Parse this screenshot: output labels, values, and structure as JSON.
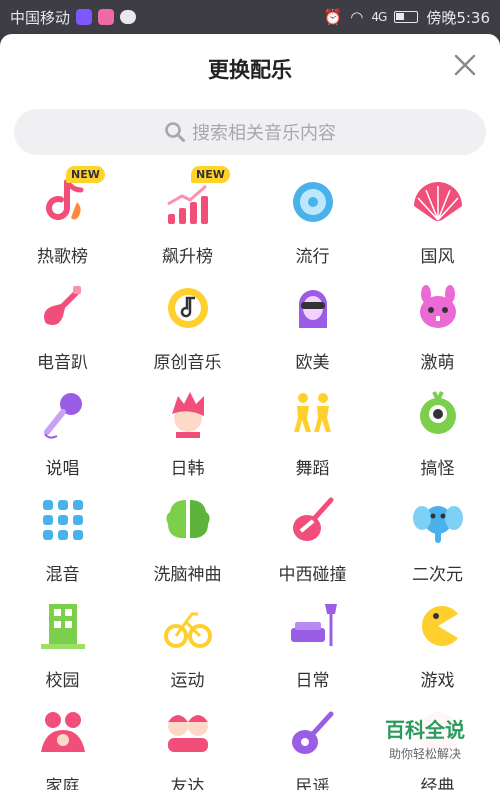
{
  "status_bar": {
    "carrier": "中国移动",
    "time_label": "傍晚5:36",
    "signal_text": "4G"
  },
  "sheet": {
    "title": "更换配乐",
    "search_placeholder": "搜索相关音乐内容"
  },
  "categories": [
    {
      "label": "热歌榜",
      "icon": "hot-song-chart-icon",
      "badge": "NEW"
    },
    {
      "label": "飙升榜",
      "icon": "rising-chart-icon",
      "badge": "NEW"
    },
    {
      "label": "流行",
      "icon": "pop-disc-icon"
    },
    {
      "label": "国风",
      "icon": "chinese-fan-icon"
    },
    {
      "label": "电音趴",
      "icon": "electric-guitar-icon"
    },
    {
      "label": "原创音乐",
      "icon": "original-music-note-icon"
    },
    {
      "label": "欧美",
      "icon": "western-singer-icon"
    },
    {
      "label": "激萌",
      "icon": "cute-rabbit-icon"
    },
    {
      "label": "说唱",
      "icon": "microphone-icon"
    },
    {
      "label": "日韩",
      "icon": "jk-boy-icon"
    },
    {
      "label": "舞蹈",
      "icon": "dancers-icon"
    },
    {
      "label": "搞怪",
      "icon": "one-eye-monster-icon"
    },
    {
      "label": "混音",
      "icon": "mixer-pads-icon"
    },
    {
      "label": "洗脑神曲",
      "icon": "brain-icon"
    },
    {
      "label": "中西碰撞",
      "icon": "pipa-guitar-icon"
    },
    {
      "label": "二次元",
      "icon": "elephant-icon"
    },
    {
      "label": "校园",
      "icon": "school-building-icon"
    },
    {
      "label": "运动",
      "icon": "bicycle-icon"
    },
    {
      "label": "日常",
      "icon": "sofa-lamp-icon"
    },
    {
      "label": "游戏",
      "icon": "pacman-icon"
    },
    {
      "label": "家庭",
      "icon": "family-icon"
    },
    {
      "label": "友达",
      "icon": "friends-icon"
    },
    {
      "label": "民谣",
      "icon": "acoustic-guitar-icon"
    },
    {
      "label": "经典",
      "icon": "classic-record-icon"
    }
  ],
  "watermark": {
    "title": "百科全说",
    "subtitle": "助你轻松解决"
  },
  "colors": {
    "pink": "#f14f7a",
    "yellow": "#ffcf2e",
    "blue": "#49b2ea",
    "purple": "#9b5de5",
    "green": "#7ccf4a",
    "badge": "#ffd42a"
  }
}
